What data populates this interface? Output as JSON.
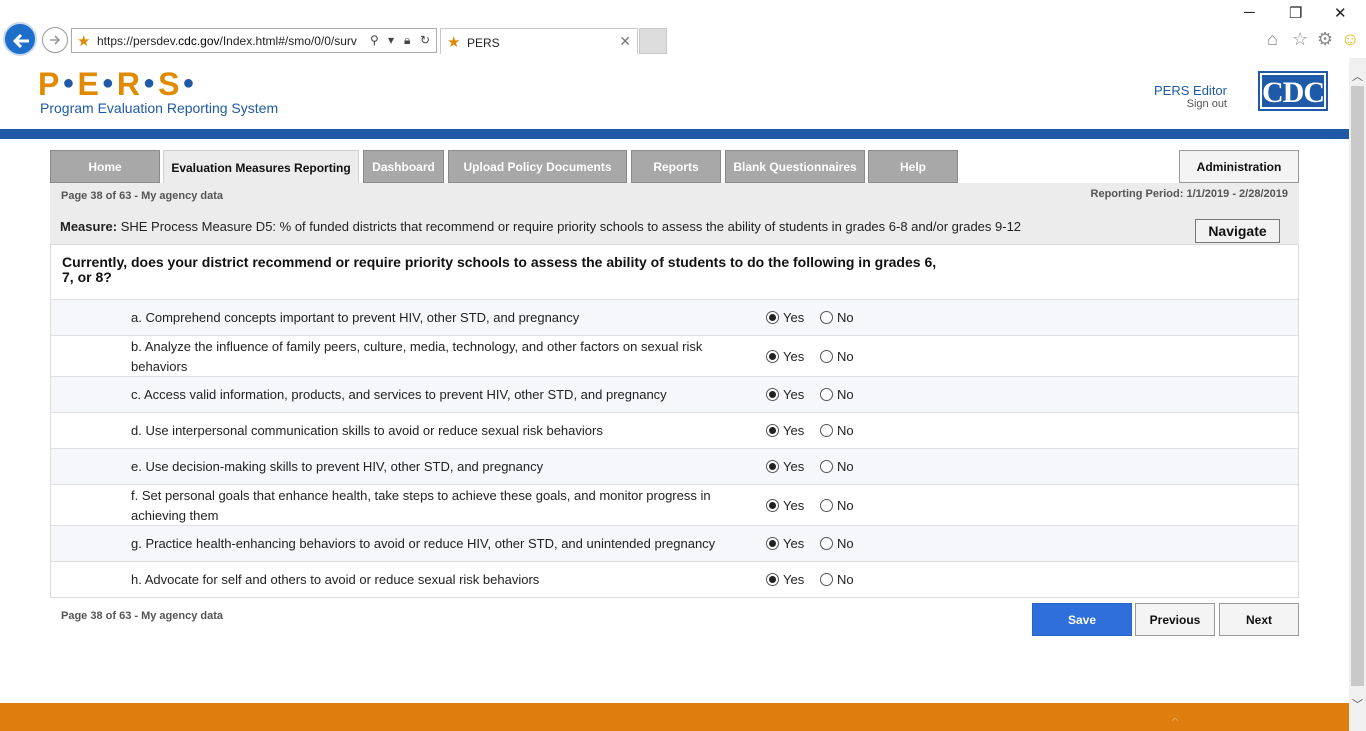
{
  "browser": {
    "url_prefix": "https://persdev.",
    "url_domain": "cdc.gov",
    "url_rest": "/Index.html#/smo/0/0/surv",
    "tab_title": "PERS"
  },
  "header": {
    "logo_letters": [
      "P",
      "E",
      "R",
      "S"
    ],
    "subtitle": "Program Evaluation Reporting System",
    "user_name": "PERS Editor",
    "sign_out": "Sign out",
    "cdc_logo": "CDC"
  },
  "nav": {
    "tabs": [
      {
        "label": "Home"
      },
      {
        "label": "Evaluation Measures Reporting"
      },
      {
        "label": "Dashboard"
      },
      {
        "label": "Upload Policy Documents"
      },
      {
        "label": "Reports"
      },
      {
        "label": "Blank Questionnaires"
      },
      {
        "label": "Help"
      }
    ],
    "active_tab": "Evaluation Measures Reporting",
    "admin": "Administration"
  },
  "page_info": "Page 38 of 63 - My agency data",
  "reporting_period": "Reporting Period: 1/1/2019 - 2/28/2019",
  "measure": {
    "label": "Measure:",
    "text": "SHE Process Measure D5: % of funded districts that recommend or require priority schools to assess the ability of students in grades 6-8 and/or grades 9-12",
    "navigate": "Navigate"
  },
  "question": "Currently, does your district recommend or require priority schools to assess the ability of students to do the following in grades 6, 7, or 8?",
  "options": {
    "yes": "Yes",
    "no": "No"
  },
  "items": [
    {
      "text": "a. Comprehend concepts important to prevent HIV, other STD, and pregnancy",
      "answer": "Yes"
    },
    {
      "text": "b. Analyze the influence of family peers, culture, media, technology, and other factors on sexual risk behaviors",
      "answer": "Yes"
    },
    {
      "text": "c. Access valid information, products, and services to prevent HIV, other STD, and pregnancy",
      "answer": "Yes"
    },
    {
      "text": "d. Use interpersonal communication skills to avoid or reduce sexual risk behaviors",
      "answer": "Yes"
    },
    {
      "text": "e. Use decision-making skills to prevent HIV, other STD, and pregnancy",
      "answer": "Yes"
    },
    {
      "text": "f. Set personal goals that enhance health, take steps to achieve these goals, and monitor progress in achieving them",
      "answer": "Yes"
    },
    {
      "text": "g. Practice health-enhancing behaviors to avoid or reduce HIV, other STD, and unintended pregnancy",
      "answer": "Yes"
    },
    {
      "text": "h. Advocate for self and others to avoid or reduce sexual risk behaviors",
      "answer": "Yes"
    }
  ],
  "buttons": {
    "save": "Save",
    "previous": "Previous",
    "next": "Next"
  },
  "colors": {
    "brand_orange": "#e08a00",
    "brand_blue": "#1e5aa8",
    "save_blue": "#2f6fdc"
  }
}
